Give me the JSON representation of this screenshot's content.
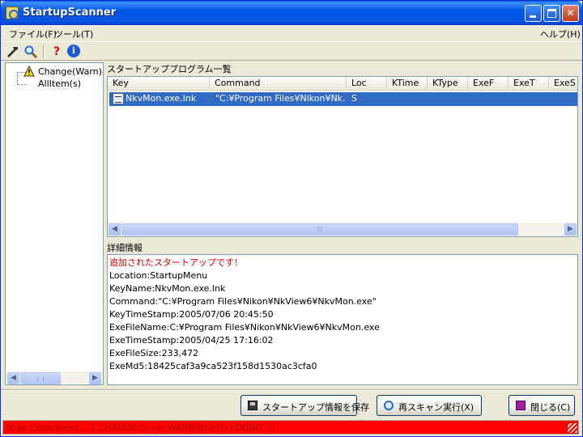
{
  "window": {
    "title": "StartupScanner"
  },
  "menu": {
    "file": "ファイル(F)",
    "tool": "ツール(T)",
    "help": "ヘルプ(H)"
  },
  "toolbar": {
    "icons": [
      "wrench-icon",
      "search-icon",
      "help-icon",
      "info-icon"
    ],
    "help_glyph": "?",
    "info_glyph": "i"
  },
  "tree": {
    "items": [
      {
        "label": "Change(Warn)It"
      },
      {
        "label": "AllItem(s)"
      }
    ]
  },
  "list": {
    "label": "スタートアッププログラム一覧",
    "columns": [
      "Key",
      "Command",
      "Loc",
      "KTime",
      "KType",
      "ExeF",
      "ExeT",
      "ExeS"
    ],
    "rows": [
      {
        "key": "NkvMon.exe.lnk",
        "command": "\"C:¥Program Files¥Nikon¥Nk...",
        "loc": "S"
      }
    ],
    "scroll_grip": "III"
  },
  "detail": {
    "label": "詳細情報",
    "lines": [
      "追加されたスタートアップです！",
      "Location:StartupMenu",
      "KeyName:NkvMon.exe.lnk",
      "Command:\"C:¥Program Files¥Nikon¥NkView6¥NkvMon.exe\"",
      "KeyTimeStamp:2005/07/06 20:45:50",
      "ExeFileName:C:¥Program Files¥Nikon¥NkView6¥NkvMon.exe",
      "ExeTimeStamp:2005/04/25 17:16:02",
      "ExeFileSize:233,472",
      "ExeMd5:18425caf3a9ca523f158d1530ac3cfa0"
    ],
    "alert_color": "#e00000"
  },
  "buttons": {
    "save": "スタートアップ情報を保存",
    "rescan": "再スキャン実行(X)",
    "close": "閉じる(C)"
  },
  "status": {
    "text": "Scan Completed... 1 CHANGE(S) (or WARNING(S)) FOUND !!!",
    "bg_color": "#ff0000"
  }
}
